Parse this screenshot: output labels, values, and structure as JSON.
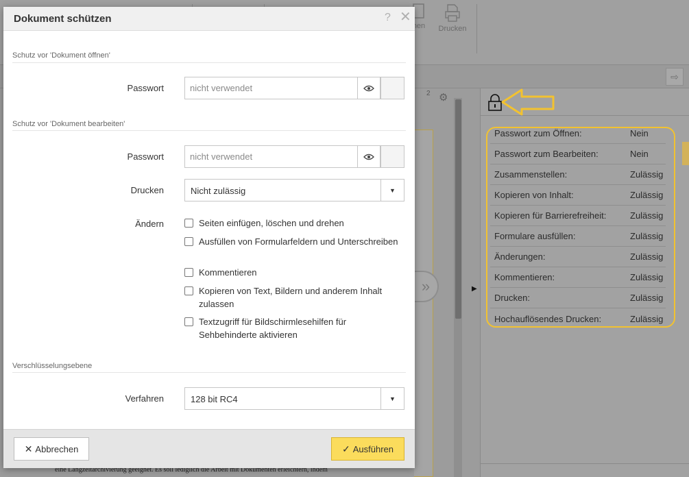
{
  "toolbar": {
    "print_label": "Drucken",
    "partial_label": "nen"
  },
  "background": {
    "page_number": "2",
    "bottom_text": "eine Langzeitarchivierung geeignet. Es soll lediglich die Arbeit mit Dokumenten erleichtern, indem"
  },
  "dialog": {
    "title": "Dokument schützen",
    "help": "?",
    "close": "✕",
    "open_section": {
      "label": "Schutz vor 'Dokument öffnen'",
      "password_label": "Passwort",
      "password_placeholder": "nicht verwendet"
    },
    "edit_section": {
      "label": "Schutz vor 'Dokument bearbeiten'",
      "password_label": "Passwort",
      "password_placeholder": "nicht verwendet",
      "print_label": "Drucken",
      "print_value": "Nicht zulässig",
      "change_label": "Ändern",
      "checkboxes": [
        {
          "text": "Seiten einfügen, löschen und drehen",
          "checked": false
        },
        {
          "text": "Ausfüllen von Formularfeldern und Unterschreiben",
          "checked": false
        },
        {
          "text": "Kommentieren",
          "checked": false
        },
        {
          "text": "Kopieren von Text, Bildern und anderem Inhalt zulassen",
          "checked": false
        },
        {
          "text": "Textzugriff für Bildschirmlesehilfen für Sehbehinderte aktivieren",
          "checked": false
        }
      ]
    },
    "encryption_section": {
      "label": "Verschlüsselungsebene",
      "method_label": "Verfahren",
      "method_value": "128 bit RC4"
    },
    "footer": {
      "cancel_label": "Abbrechen",
      "ok_label": "Ausführen"
    }
  },
  "properties": [
    {
      "key": "Passwort zum Öffnen:",
      "value": "Nein"
    },
    {
      "key": "Passwort zum Bearbeiten:",
      "value": "Nein"
    },
    {
      "key": "Zusammenstellen:",
      "value": "Zulässig"
    },
    {
      "key": "Kopieren von Inhalt:",
      "value": "Zulässig"
    },
    {
      "key": "Kopieren für Barrierefreiheit:",
      "value": "Zulässig"
    },
    {
      "key": "Formulare ausfüllen:",
      "value": "Zulässig"
    },
    {
      "key": "Änderungen:",
      "value": "Zulässig"
    },
    {
      "key": "Kommentieren:",
      "value": "Zulässig"
    },
    {
      "key": "Drucken:",
      "value": "Zulässig"
    },
    {
      "key": "Hochauflösendes Drucken:",
      "value": "Zulässig"
    }
  ],
  "colors": {
    "accent_yellow": "#fbdc5c",
    "highlight": "#f2c230"
  },
  "icons": {
    "lock": "lock-icon",
    "eye": "eye-icon",
    "callout": "arrow-left-callout-icon"
  }
}
